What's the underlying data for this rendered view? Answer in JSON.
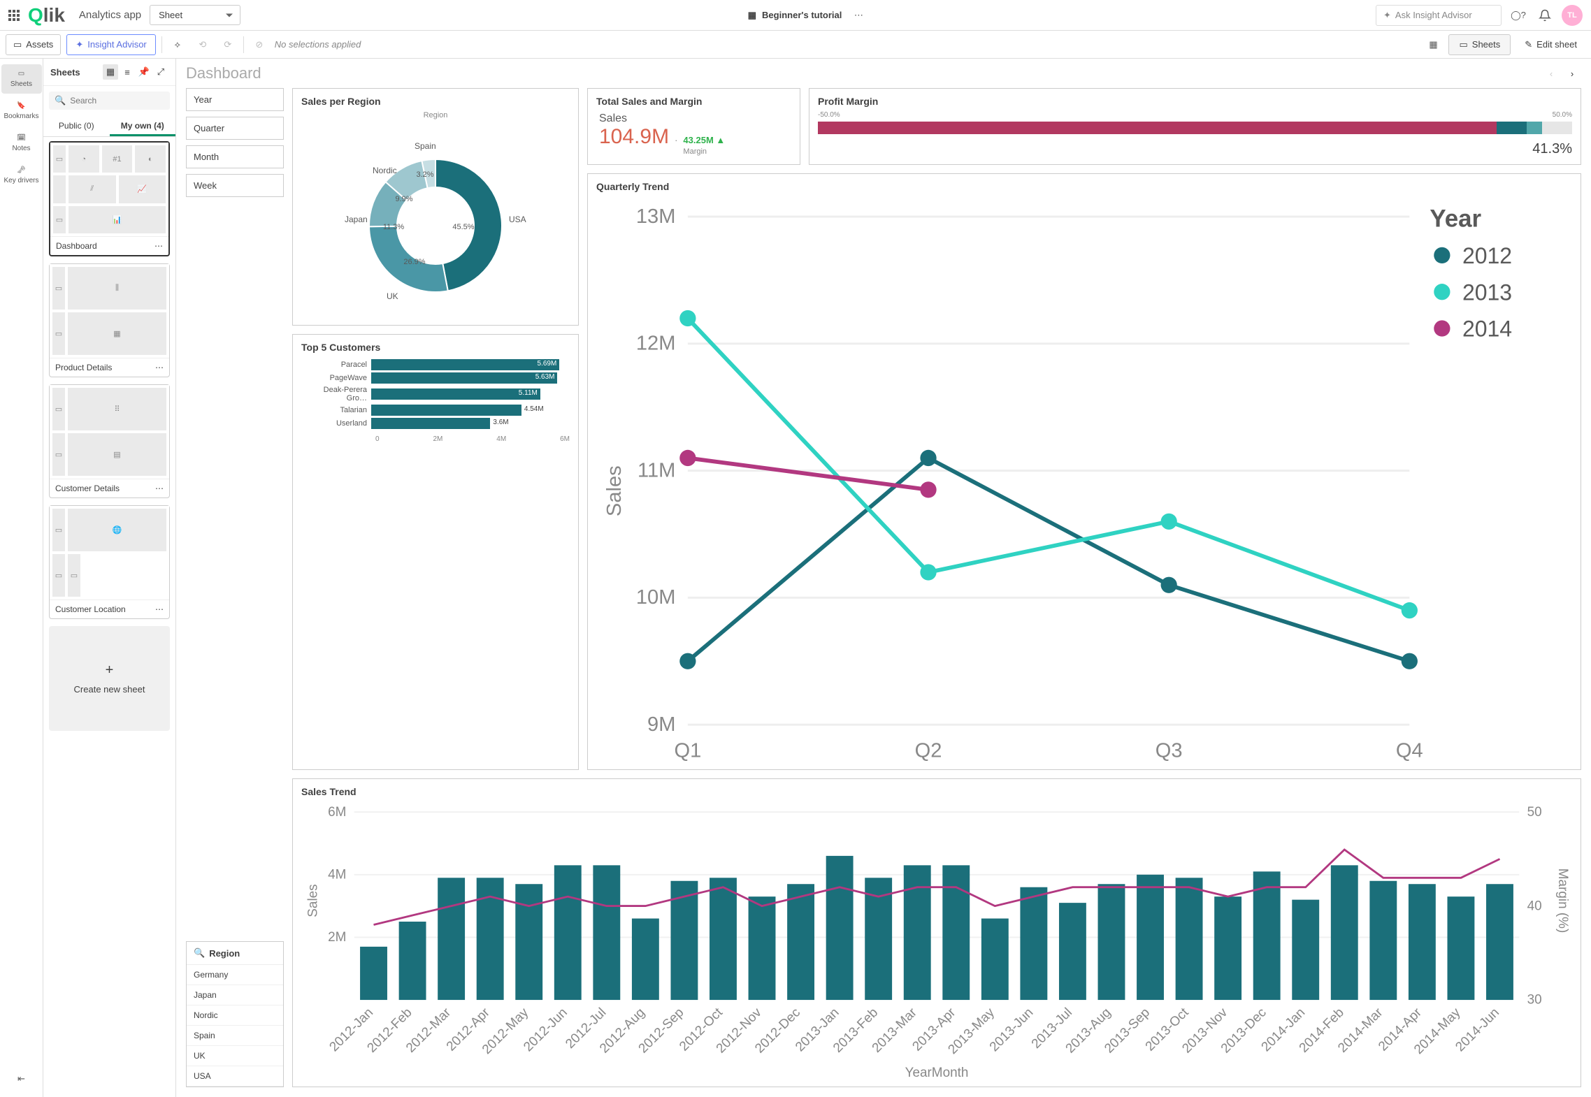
{
  "topbar": {
    "app_name": "Analytics app",
    "sheet_dropdown": "Sheet",
    "tutorial": "Beginner's tutorial",
    "ask_placeholder": "Ask Insight Advisor",
    "avatar": "TL"
  },
  "subbar": {
    "assets": "Assets",
    "insight_advisor": "Insight Advisor",
    "no_selections": "No selections applied",
    "sheets": "Sheets",
    "edit_sheet": "Edit sheet"
  },
  "rail": {
    "sheets": "Sheets",
    "bookmarks": "Bookmarks",
    "notes": "Notes",
    "key_drivers": "Key drivers"
  },
  "sheets_panel": {
    "title": "Sheets",
    "search_placeholder": "Search",
    "tab_public": "Public (0)",
    "tab_myown": "My own (4)",
    "cards": [
      "Dashboard",
      "Product Details",
      "Customer Details",
      "Customer Location"
    ],
    "new_sheet": "Create new sheet"
  },
  "dashboard": {
    "title": "Dashboard",
    "time_filters": [
      "Year",
      "Quarter",
      "Month",
      "Week"
    ],
    "region_filter": {
      "title": "Region",
      "items": [
        "Germany",
        "Japan",
        "Nordic",
        "Spain",
        "UK",
        "USA"
      ]
    }
  },
  "cards": {
    "sales_region": {
      "title": "Sales per Region",
      "legend": "Region"
    },
    "total": {
      "title": "Total Sales and Margin",
      "kpi_label": "Sales",
      "kpi_main": "104.9M",
      "kpi_sub": "43.25M",
      "kpi_sub_arrow": "▲",
      "kpi_sub_label": "Margin"
    },
    "profit_margin": {
      "title": "Profit Margin",
      "scale_low": "-50.0%",
      "scale_high": "50.0%",
      "value": "41.3%"
    },
    "top5": {
      "title": "Top 5 Customers"
    },
    "qtrend": {
      "title": "Quarterly Trend",
      "legend_title": "Year",
      "ylabel": "Sales"
    },
    "salestrend": {
      "title": "Sales Trend",
      "ylabel": "Sales",
      "y2label": "Margin (%)",
      "xlabel": "YearMonth"
    }
  },
  "chart_data": [
    {
      "id": "sales_per_region",
      "type": "pie",
      "categories": [
        "USA",
        "UK",
        "Japan",
        "Nordic",
        "Spain"
      ],
      "values": [
        45.5,
        26.9,
        11.3,
        9.9,
        3.2
      ],
      "labels": [
        "45.5%",
        "26.9%",
        "11.3%",
        "9.9%",
        "3.2%"
      ],
      "colors": [
        "#1b6f7a",
        "#4a97a6",
        "#76b0bb",
        "#9ec7cf",
        "#c6dee3"
      ],
      "title": "Sales per Region",
      "donut": true
    },
    {
      "id": "top5_customers",
      "type": "bar",
      "orientation": "horizontal",
      "categories": [
        "Paracel",
        "PageWave",
        "Deak-Perera Gro…",
        "Talarian",
        "Userland"
      ],
      "values": [
        5.69,
        5.63,
        5.11,
        4.54,
        3.6
      ],
      "value_labels": [
        "5.69M",
        "5.63M",
        "5.11M",
        "4.54M",
        "3.6M"
      ],
      "xlim": [
        0,
        6
      ],
      "xticks": [
        "0",
        "2M",
        "4M",
        "6M"
      ],
      "title": "Top 5 Customers"
    },
    {
      "id": "quarterly_trend",
      "type": "line",
      "categories": [
        "Q1",
        "Q2",
        "Q3",
        "Q4"
      ],
      "series": [
        {
          "name": "2012",
          "color": "#1b6f7a",
          "values": [
            9.5,
            11.1,
            10.1,
            9.5
          ]
        },
        {
          "name": "2013",
          "color": "#2fd2c2",
          "values": [
            12.2,
            10.2,
            10.6,
            9.9
          ]
        },
        {
          "name": "2014",
          "color": "#b23880",
          "values": [
            11.1,
            10.85,
            null,
            null
          ]
        }
      ],
      "ylim": [
        9,
        13
      ],
      "yticks": [
        "9M",
        "10M",
        "11M",
        "12M",
        "13M"
      ],
      "ylabel": "Sales",
      "title": "Quarterly Trend"
    },
    {
      "id": "sales_trend",
      "type": "combo",
      "categories": [
        "2012-Jan",
        "2012-Feb",
        "2012-Mar",
        "2012-Apr",
        "2012-May",
        "2012-Jun",
        "2012-Jul",
        "2012-Aug",
        "2012-Sep",
        "2012-Oct",
        "2012-Nov",
        "2012-Dec",
        "2013-Jan",
        "2013-Feb",
        "2013-Mar",
        "2013-Apr",
        "2013-May",
        "2013-Jun",
        "2013-Jul",
        "2013-Aug",
        "2013-Sep",
        "2013-Oct",
        "2013-Nov",
        "2013-Dec",
        "2014-Jan",
        "2014-Feb",
        "2014-Mar",
        "2014-Apr",
        "2014-May",
        "2014-Jun"
      ],
      "series": [
        {
          "name": "Sales",
          "type": "bar",
          "color": "#1b6f7a",
          "values": [
            1.7,
            2.5,
            3.9,
            3.9,
            3.7,
            4.3,
            4.3,
            2.6,
            3.8,
            3.9,
            3.3,
            3.7,
            4.6,
            3.9,
            4.3,
            4.3,
            2.6,
            3.6,
            3.1,
            3.7,
            4.0,
            3.9,
            3.3,
            4.1,
            3.2,
            4.3,
            3.8,
            3.7,
            3.3,
            3.7
          ]
        },
        {
          "name": "Margin (%)",
          "type": "line",
          "color": "#b23880",
          "axis": "y2",
          "values": [
            38,
            39,
            40,
            41,
            40,
            41,
            40,
            40,
            41,
            42,
            40,
            41,
            42,
            41,
            42,
            42,
            40,
            41,
            42,
            42,
            42,
            42,
            41,
            42,
            42,
            46,
            43,
            43,
            43,
            45
          ]
        }
      ],
      "ylim": [
        0,
        6
      ],
      "yticks": [
        "2M",
        "4M",
        "6M"
      ],
      "y2lim": [
        30,
        50
      ],
      "y2ticks": [
        "30",
        "40",
        "50"
      ],
      "title": "Sales Trend",
      "xlabel": "YearMonth"
    },
    {
      "id": "profit_margin",
      "type": "bullet",
      "range": [
        -50,
        50
      ],
      "value": 41.3,
      "segments": [
        {
          "from": -50,
          "to": 40,
          "color": "#b23860"
        },
        {
          "from": 40,
          "to": 44,
          "color": "#1b6f7a"
        },
        {
          "from": 44,
          "to": 46,
          "color": "#51a7aa"
        }
      ]
    }
  ]
}
